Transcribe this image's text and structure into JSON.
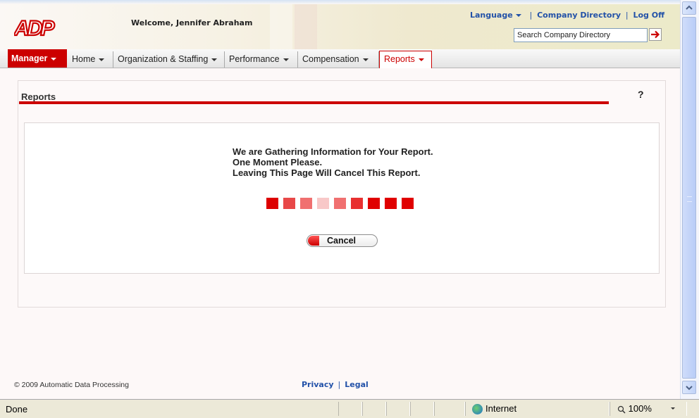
{
  "header": {
    "logo_text": "ADP",
    "welcome": "Welcome, Jennifer Abraham",
    "links": {
      "language": "Language",
      "company_directory": "Company Directory",
      "log_off": "Log Off",
      "separator": "|"
    },
    "search": {
      "value": "Search Company Directory"
    }
  },
  "nav": {
    "items": [
      {
        "label": "Manager"
      },
      {
        "label": "Home"
      },
      {
        "label": "Organization & Staffing"
      },
      {
        "label": "Performance"
      },
      {
        "label": "Compensation"
      },
      {
        "label": "Reports"
      }
    ],
    "active": "Reports"
  },
  "page": {
    "title": "Reports",
    "help": "?",
    "message_lines": [
      "We are Gathering Information for Your Report.",
      "One Moment Please.",
      "Leaving This Page Will Cancel This Report."
    ],
    "progress_squares": [
      "#dd0000",
      "#e84848",
      "#f07070",
      "#f8c8c8",
      "#f07070",
      "#e83030",
      "#e00000",
      "#e00000",
      "#e00000"
    ],
    "cancel_label": "Cancel"
  },
  "footer": {
    "copyright": "© 2009 Automatic Data Processing",
    "privacy": "Privacy",
    "legal": "Legal",
    "separator": "|"
  },
  "statusbar": {
    "status": "Done",
    "zone": "Internet",
    "zoom": "100%"
  },
  "colors": {
    "brand_red": "#cc0000",
    "link_blue": "#2251a8"
  }
}
